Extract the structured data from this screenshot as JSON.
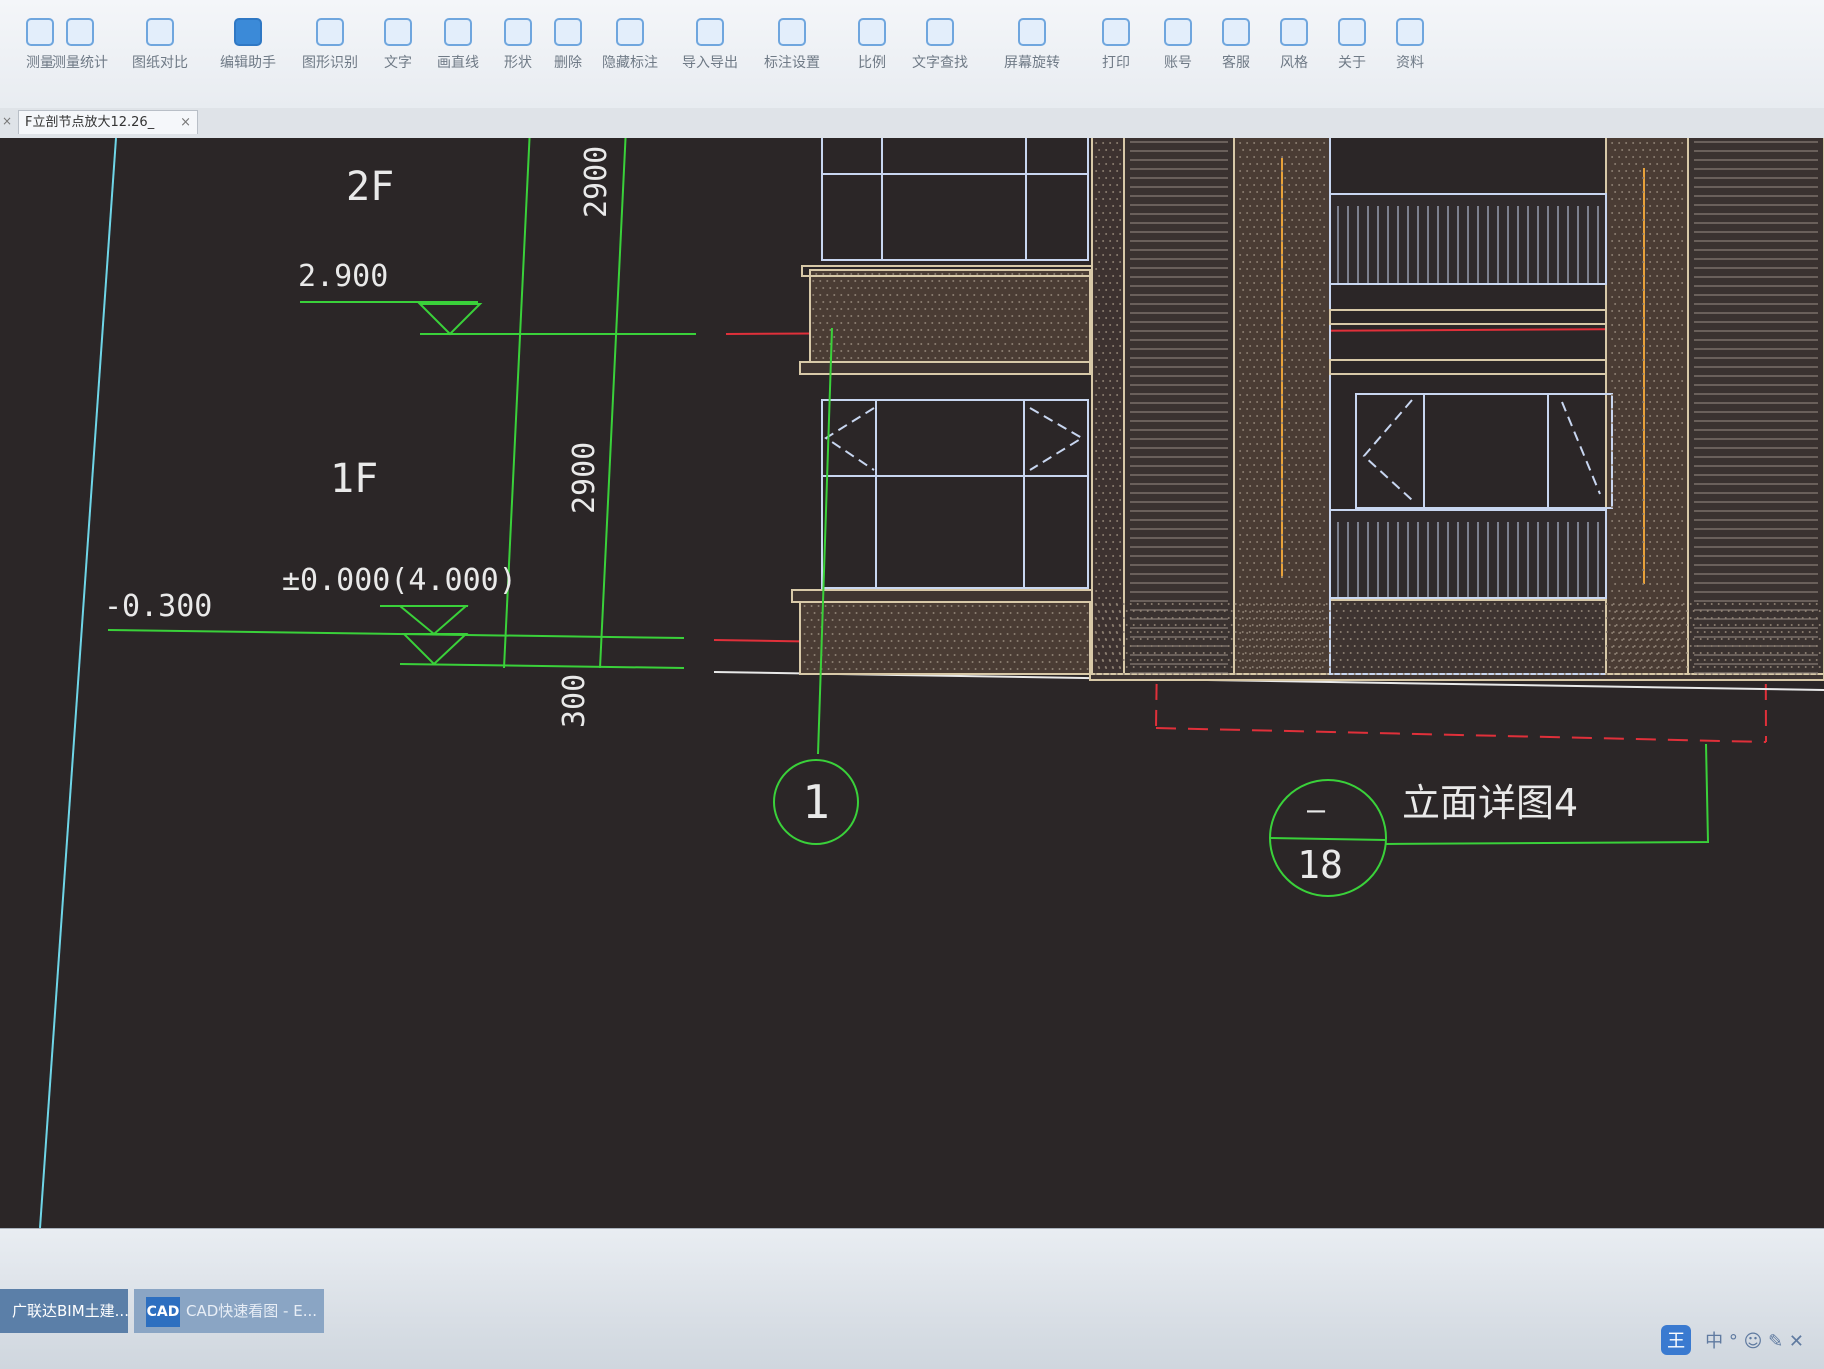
{
  "toolbar": {
    "items": [
      {
        "label": "测量",
        "icon": "ruler-icon"
      },
      {
        "label": "测量统计",
        "icon": "stats-icon"
      },
      {
        "label": "图纸对比",
        "icon": "compare-icon"
      },
      {
        "label": "编辑助手",
        "icon": "edit-assistant-icon"
      },
      {
        "label": "图形识别",
        "icon": "shape-recognition-icon"
      },
      {
        "label": "文字",
        "icon": "text-icon"
      },
      {
        "label": "画直线",
        "icon": "line-icon"
      },
      {
        "label": "形状",
        "icon": "shape-icon"
      },
      {
        "label": "删除",
        "icon": "eraser-icon"
      },
      {
        "label": "隐藏标注",
        "icon": "hide-annotation-icon"
      },
      {
        "label": "导入导出",
        "icon": "import-export-icon"
      },
      {
        "label": "标注设置",
        "icon": "annotation-settings-icon"
      },
      {
        "label": "比例",
        "icon": "scale-icon"
      },
      {
        "label": "文字查找",
        "icon": "text-search-icon"
      },
      {
        "label": "屏幕旋转",
        "icon": "rotate-screen-icon"
      },
      {
        "label": "打印",
        "icon": "print-icon"
      },
      {
        "label": "账号",
        "icon": "account-icon"
      },
      {
        "label": "客服",
        "icon": "headset-icon"
      },
      {
        "label": "风格",
        "icon": "style-icon"
      },
      {
        "label": "关于",
        "icon": "info-icon"
      },
      {
        "label": "资料",
        "icon": "documents-icon"
      }
    ]
  },
  "tabs": {
    "active_label": "F立剖节点放大12.26_",
    "close_glyph": "×",
    "left_close_glyph": "×"
  },
  "drawing": {
    "levels": {
      "floor2_label": "2F",
      "floor1_label": "1F",
      "elev_2900": "2.900",
      "elev_0": "±0.000(4.000)",
      "elev_minus": "-0.300"
    },
    "dimensions": {
      "dim_top": "2900",
      "dim_mid": "2900",
      "dim_bottom": "300"
    },
    "grid_bubble": "1",
    "detail_callout": {
      "title": "立面详图4",
      "top_text": "—",
      "bottom_text": "18"
    },
    "colors": {
      "background": "#2b2627",
      "dimension_green": "#3ad13a",
      "axis_red": "#e0303a",
      "window_blue": "#c8d6f0",
      "facade_tan": "#d8c9a8",
      "white_line": "#e9e9e9"
    }
  },
  "taskbar": {
    "app_a": "广联达BIM土建...",
    "app_b_logo": "CAD",
    "app_b": "CAD快速看图 - E...",
    "ime": "王",
    "tray_text": "中 ° ☺ ✎ ✕"
  }
}
